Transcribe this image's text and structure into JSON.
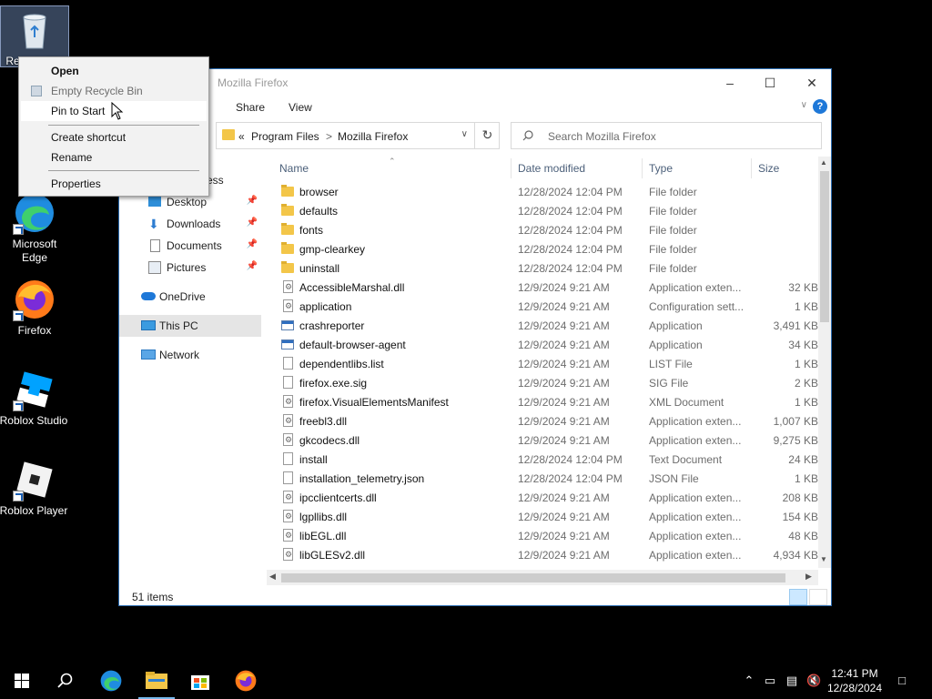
{
  "desktop": {
    "icons": [
      {
        "label": "Recycle Bin"
      },
      {
        "label": "Microsoft Edge"
      },
      {
        "label": "Firefox"
      },
      {
        "label": "Roblox Studio"
      },
      {
        "label": "Roblox Player"
      }
    ]
  },
  "window": {
    "title": "Mozilla Firefox",
    "ribbon_tabs": [
      "Share",
      "View"
    ],
    "address": {
      "overflow": "«",
      "segments": [
        "Program Files",
        "Mozilla Firefox"
      ],
      "separator": ">"
    },
    "search": {
      "placeholder": "Search Mozilla Firefox"
    },
    "nav": {
      "quick_access_partial": "ess",
      "items": [
        {
          "label": "Desktop",
          "pinned": true
        },
        {
          "label": "Downloads",
          "pinned": true
        },
        {
          "label": "Documents",
          "pinned": true
        },
        {
          "label": "Pictures",
          "pinned": true
        },
        {
          "label": "OneDrive"
        },
        {
          "label": "This PC",
          "selected": true
        },
        {
          "label": "Network"
        }
      ]
    },
    "columns": [
      "Name",
      "Date modified",
      "Type",
      "Size"
    ],
    "files": [
      {
        "name": "browser",
        "date": "12/28/2024 12:04 PM",
        "type": "File folder",
        "size": "",
        "icon": "folder"
      },
      {
        "name": "defaults",
        "date": "12/28/2024 12:04 PM",
        "type": "File folder",
        "size": "",
        "icon": "folder"
      },
      {
        "name": "fonts",
        "date": "12/28/2024 12:04 PM",
        "type": "File folder",
        "size": "",
        "icon": "folder"
      },
      {
        "name": "gmp-clearkey",
        "date": "12/28/2024 12:04 PM",
        "type": "File folder",
        "size": "",
        "icon": "folder"
      },
      {
        "name": "uninstall",
        "date": "12/28/2024 12:04 PM",
        "type": "File folder",
        "size": "",
        "icon": "folder"
      },
      {
        "name": "AccessibleMarshal.dll",
        "date": "12/9/2024 9:21 AM",
        "type": "Application exten...",
        "size": "32 KB",
        "icon": "config"
      },
      {
        "name": "application",
        "date": "12/9/2024 9:21 AM",
        "type": "Configuration sett...",
        "size": "1 KB",
        "icon": "config"
      },
      {
        "name": "crashreporter",
        "date": "12/9/2024 9:21 AM",
        "type": "Application",
        "size": "3,491 KB",
        "icon": "app"
      },
      {
        "name": "default-browser-agent",
        "date": "12/9/2024 9:21 AM",
        "type": "Application",
        "size": "34 KB",
        "icon": "app"
      },
      {
        "name": "dependentlibs.list",
        "date": "12/9/2024 9:21 AM",
        "type": "LIST File",
        "size": "1 KB",
        "icon": "file"
      },
      {
        "name": "firefox.exe.sig",
        "date": "12/9/2024 9:21 AM",
        "type": "SIG File",
        "size": "2 KB",
        "icon": "file"
      },
      {
        "name": "firefox.VisualElementsManifest",
        "date": "12/9/2024 9:21 AM",
        "type": "XML Document",
        "size": "1 KB",
        "icon": "config"
      },
      {
        "name": "freebl3.dll",
        "date": "12/9/2024 9:21 AM",
        "type": "Application exten...",
        "size": "1,007 KB",
        "icon": "config"
      },
      {
        "name": "gkcodecs.dll",
        "date": "12/9/2024 9:21 AM",
        "type": "Application exten...",
        "size": "9,275 KB",
        "icon": "config"
      },
      {
        "name": "install",
        "date": "12/28/2024 12:04 PM",
        "type": "Text Document",
        "size": "24 KB",
        "icon": "file"
      },
      {
        "name": "installation_telemetry.json",
        "date": "12/28/2024 12:04 PM",
        "type": "JSON File",
        "size": "1 KB",
        "icon": "file"
      },
      {
        "name": "ipcclientcerts.dll",
        "date": "12/9/2024 9:21 AM",
        "type": "Application exten...",
        "size": "208 KB",
        "icon": "config"
      },
      {
        "name": "lgpllibs.dll",
        "date": "12/9/2024 9:21 AM",
        "type": "Application exten...",
        "size": "154 KB",
        "icon": "config"
      },
      {
        "name": "libEGL.dll",
        "date": "12/9/2024 9:21 AM",
        "type": "Application exten...",
        "size": "48 KB",
        "icon": "config"
      },
      {
        "name": "libGLESv2.dll",
        "date": "12/9/2024 9:21 AM",
        "type": "Application exten...",
        "size": "4,934 KB",
        "icon": "config"
      }
    ],
    "status": "51 items"
  },
  "context_menu": {
    "items": [
      {
        "label": "Open",
        "bold": true
      },
      {
        "label": "Empty Recycle Bin",
        "disabled": true,
        "icon": "recycle-bin-icon"
      },
      {
        "label": "Pin to Start",
        "hover": true
      },
      {
        "label": "Create shortcut"
      },
      {
        "label": "Rename"
      },
      {
        "label": "Properties"
      }
    ]
  },
  "taskbar": {
    "time": "12:41 PM",
    "date": "12/28/2024"
  },
  "colors": {
    "accent": "#1e78d8",
    "folder": "#f3c649",
    "selection": "#cce8ff"
  }
}
